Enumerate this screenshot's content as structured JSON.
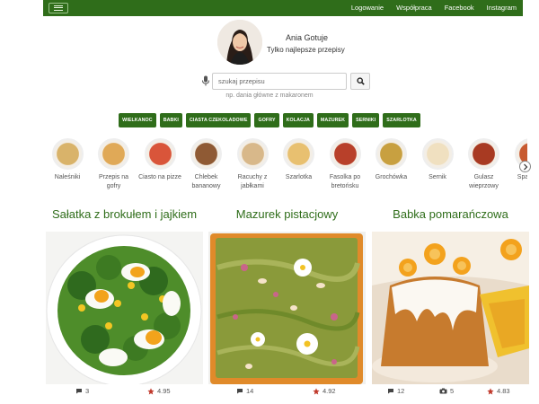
{
  "nav": {
    "links": [
      "Logowanie",
      "Współpraca",
      "Facebook",
      "Instagram"
    ]
  },
  "profile": {
    "name": "Ania Gotuje",
    "tagline": "Tylko najlepsze przepisy"
  },
  "search": {
    "placeholder": "szukaj przepisu",
    "hint": "np. dania główne z makaronem"
  },
  "tags": [
    "WIELKANOC",
    "BABKI",
    "CIASTA CZEKOLADOWE",
    "GOFRY",
    "KOLACJA",
    "MAZUREK",
    "SERNIKI",
    "SZARLOTKA"
  ],
  "categories": [
    {
      "label": "Naleśniki",
      "icon": "pancakes-thumb",
      "color": "#d9b36a"
    },
    {
      "label": "Przepis na gofry",
      "icon": "waffles-thumb",
      "color": "#e0a957"
    },
    {
      "label": "Ciasto na pizze",
      "icon": "pizza-thumb",
      "color": "#d9553a"
    },
    {
      "label": "Chlebek bananowy",
      "icon": "banana-bread-thumb",
      "color": "#8f5a34"
    },
    {
      "label": "Racuchy z jabłkami",
      "icon": "apple-fritters-thumb",
      "color": "#d8b88a"
    },
    {
      "label": "Szarlotka",
      "icon": "apple-pie-thumb",
      "color": "#e8c070"
    },
    {
      "label": "Fasolka po bretońsku",
      "icon": "beans-thumb",
      "color": "#b8402a"
    },
    {
      "label": "Grochówka",
      "icon": "pea-soup-thumb",
      "color": "#c8a040"
    },
    {
      "label": "Sernik",
      "icon": "cheesecake-thumb",
      "color": "#f0e0c0"
    },
    {
      "label": "Gulasz wieprzowy",
      "icon": "goulash-thumb",
      "color": "#a83a22"
    },
    {
      "label": "Spa Bolo",
      "icon": "spaghetti-thumb",
      "color": "#c85a30"
    }
  ],
  "cards": [
    {
      "title": "Sałatka z brokułem i jajkiem",
      "comments": "3",
      "rating": "4.95",
      "photos": ""
    },
    {
      "title": "Mazurek pistacjowy",
      "comments": "14",
      "rating": "4.92",
      "photos": ""
    },
    {
      "title": "Babka pomarańczowa",
      "comments": "12",
      "rating": "4.83",
      "photos": "5"
    }
  ],
  "colors": {
    "brand": "#2f6d1a",
    "star": "#c0392b"
  }
}
